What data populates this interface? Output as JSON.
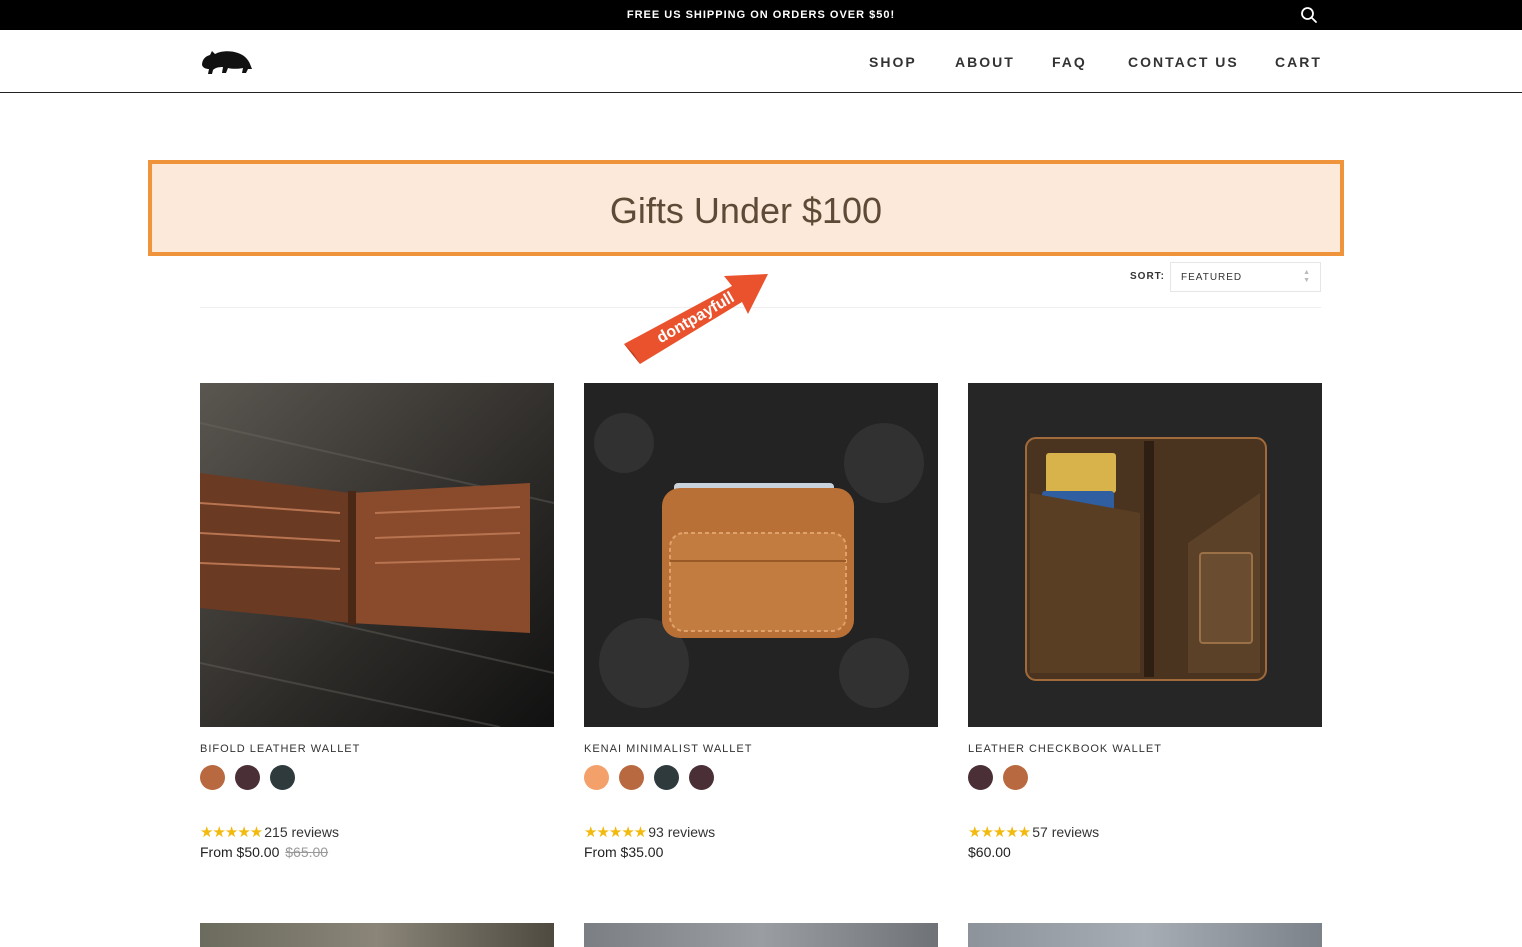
{
  "topbar": {
    "announcement": "FREE US SHIPPING ON ORDERS OVER $50!",
    "search_icon": "search-icon"
  },
  "header": {
    "logo_icon": "bear-logo-icon",
    "nav": [
      {
        "label": "SHOP"
      },
      {
        "label": "ABOUT"
      },
      {
        "label": "FAQ"
      },
      {
        "label": "CONTACT US"
      },
      {
        "label": "CART"
      }
    ]
  },
  "banner": {
    "title": "Gifts Under $100"
  },
  "sort": {
    "label": "SORT:",
    "value": "FEATURED"
  },
  "watermark": {
    "badge_text": "dontpayfull"
  },
  "products": [
    {
      "title": "BIFOLD LEATHER WALLET",
      "image": "bifold-wallet-photo",
      "swatches": [
        "#b8693f",
        "#4a2f36",
        "#2e3a3c"
      ],
      "stars": "★★★★★",
      "reviews": "215 reviews",
      "price": "From $50.00",
      "compare_price": "$65.00"
    },
    {
      "title": "KENAI MINIMALIST WALLET",
      "image": "minimalist-wallet-photo",
      "swatches": [
        "#f4a06a",
        "#b8693f",
        "#2e3a3c",
        "#4a2f36"
      ],
      "stars": "★★★★★",
      "reviews": "93 reviews",
      "price": "From $35.00",
      "compare_price": ""
    },
    {
      "title": "LEATHER CHECKBOOK WALLET",
      "image": "checkbook-wallet-photo",
      "swatches": [
        "#4a2f36",
        "#b8693f"
      ],
      "stars": "★★★★★",
      "reviews": "57 reviews",
      "price": "$60.00",
      "compare_price": ""
    }
  ],
  "colors": {
    "banner_border": "#f0943c",
    "banner_bg": "#fde9d9",
    "star": "#f2b90f"
  }
}
